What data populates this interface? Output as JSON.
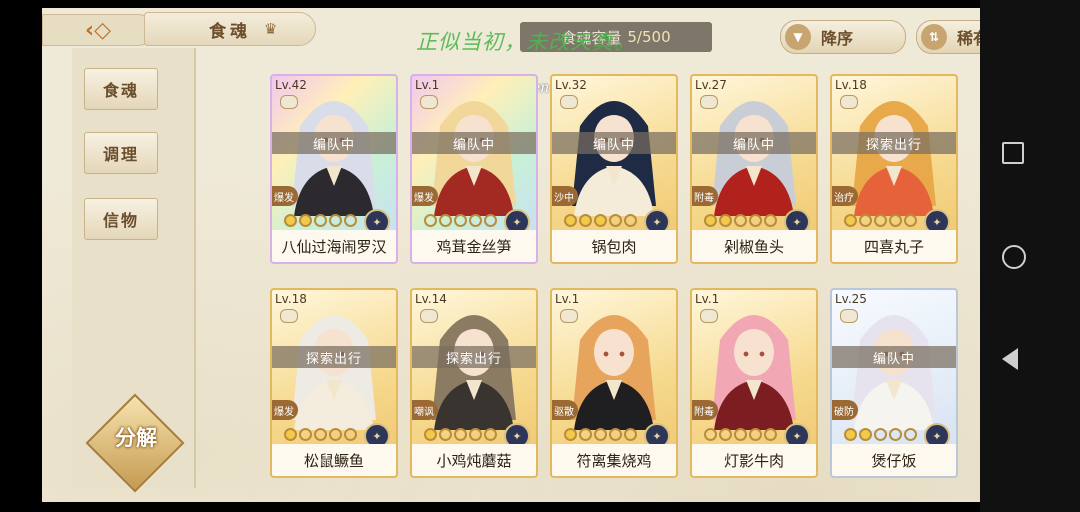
{
  "header": {
    "back_icon": "diamond-back-arrow",
    "title": "食魂",
    "crown_icon": "crown-icon",
    "capacity_label": "食魂容量",
    "capacity_value": "5/500",
    "sort_label": "降序",
    "rarity_label": "稀有度",
    "watermark": "正似当初，未改天真。",
    "watermark2": "en"
  },
  "sidebar": {
    "tabs": [
      {
        "label": "食魂",
        "active": true
      },
      {
        "label": "调理",
        "active": false
      },
      {
        "label": "信物",
        "active": false
      }
    ],
    "decompose_label": "分解"
  },
  "cards": [
    {
      "level": "Lv.42",
      "status": "编队中",
      "tag": "爆发",
      "name": "八仙过海闹罗汉",
      "stars": 2,
      "frame": "rainbow",
      "hair": "#d8dde9",
      "cloth": "#2c2a2e"
    },
    {
      "level": "Lv.1",
      "status": "编队中",
      "tag": "爆发",
      "name": "鸡茸金丝笋",
      "stars": 0,
      "frame": "rainbow",
      "hair": "#f1d79a",
      "cloth": "#a32a22"
    },
    {
      "level": "Lv.32",
      "status": "编队中",
      "tag": "沙中",
      "name": "锅包肉",
      "stars": 3,
      "frame": "gold",
      "hair": "#1f2a44",
      "cloth": "#f4ecd8"
    },
    {
      "level": "Lv.27",
      "status": "编队中",
      "tag": "附毒",
      "name": "剁椒鱼头",
      "stars": 2,
      "frame": "gold",
      "hair": "#c9ced6",
      "cloth": "#b2221c"
    },
    {
      "level": "Lv.18",
      "status": "探索出行",
      "tag": "治疗",
      "name": "四喜丸子",
      "stars": 1,
      "frame": "gold",
      "hair": "#e8a94a",
      "cloth": "#e5623a"
    },
    {
      "level": "Lv.18",
      "status": "探索出行",
      "tag": "爆发",
      "name": "松鼠鳜鱼",
      "stars": 1,
      "frame": "gold",
      "hair": "#eeeae4",
      "cloth": "#f4ecdc"
    },
    {
      "level": "Lv.14",
      "status": "探索出行",
      "tag": "嘲讽",
      "name": "小鸡炖蘑菇",
      "stars": 1,
      "frame": "gold",
      "hair": "#8b7b62",
      "cloth": "#3a3430"
    },
    {
      "level": "Lv.1",
      "status": "",
      "tag": "驱散",
      "name": "符离集烧鸡",
      "stars": 1,
      "frame": "gold",
      "hair": "#e7a45c",
      "cloth": "#1f1f22"
    },
    {
      "level": "Lv.1",
      "status": "",
      "tag": "附毒",
      "name": "灯影牛肉",
      "stars": 0,
      "frame": "gold",
      "hair": "#f2a7b5",
      "cloth": "#7c1d22"
    },
    {
      "level": "Lv.25",
      "status": "编队中",
      "tag": "破防",
      "name": "煲仔饭",
      "stars": 2,
      "frame": "silver",
      "hair": "#e6e3ee",
      "cloth": "#f6f4ef"
    }
  ],
  "colors": {
    "accent_gold": "#e3b85f",
    "active_tab": "#9ad6cd",
    "panel_bg": "#efe9d7"
  }
}
